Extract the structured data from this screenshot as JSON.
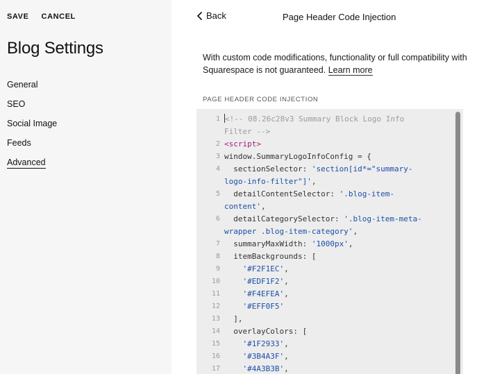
{
  "top_actions": {
    "save": "SAVE",
    "cancel": "CANCEL"
  },
  "left": {
    "title": "Blog Settings",
    "nav": [
      {
        "label": "General",
        "active": false
      },
      {
        "label": "SEO",
        "active": false
      },
      {
        "label": "Social Image",
        "active": false
      },
      {
        "label": "Feeds",
        "active": false
      },
      {
        "label": "Advanced",
        "active": true
      }
    ]
  },
  "right": {
    "back_label": "Back",
    "header_title": "Page Header Code Injection",
    "warning_text": "With custom code modifications, functionality or full compatibility with Squarespace is not guaranteed.",
    "learn_more": "Learn more",
    "section_label": "PAGE HEADER CODE INJECTION"
  },
  "code_lines": [
    {
      "num": "1",
      "parts": [
        {
          "t": "<!-- 08.26c28v3 Summary Block Logo Info Filter -->",
          "c": "comment"
        }
      ]
    },
    {
      "num": "2",
      "parts": [
        {
          "t": "<script>",
          "c": "tag"
        }
      ]
    },
    {
      "num": "3",
      "parts": [
        {
          "t": "window.SummaryLogoInfoConfig = {",
          "c": ""
        }
      ]
    },
    {
      "num": "4",
      "parts": [
        {
          "t": "  sectionSelector: ",
          "c": ""
        },
        {
          "t": "'section[id*=\"summary-logo-info-filter\"]'",
          "c": "str"
        },
        {
          "t": ",",
          "c": ""
        }
      ]
    },
    {
      "num": "5",
      "parts": [
        {
          "t": "  detailContentSelector: ",
          "c": ""
        },
        {
          "t": "'.blog-item-content'",
          "c": "str"
        },
        {
          "t": ",",
          "c": ""
        }
      ]
    },
    {
      "num": "6",
      "parts": [
        {
          "t": "  detailCategorySelector: ",
          "c": ""
        },
        {
          "t": "'.blog-item-meta-wrapper .blog-item-category'",
          "c": "str"
        },
        {
          "t": ",",
          "c": ""
        }
      ]
    },
    {
      "num": "7",
      "parts": [
        {
          "t": "  summaryMaxWidth: ",
          "c": ""
        },
        {
          "t": "'1000px'",
          "c": "str"
        },
        {
          "t": ",",
          "c": ""
        }
      ]
    },
    {
      "num": "8",
      "parts": [
        {
          "t": "  itemBackgrounds: [",
          "c": ""
        }
      ]
    },
    {
      "num": "9",
      "parts": [
        {
          "t": "    ",
          "c": ""
        },
        {
          "t": "'#F2F1EC'",
          "c": "str"
        },
        {
          "t": ",",
          "c": ""
        }
      ]
    },
    {
      "num": "10",
      "parts": [
        {
          "t": "    ",
          "c": ""
        },
        {
          "t": "'#EDF1F2'",
          "c": "str"
        },
        {
          "t": ",",
          "c": ""
        }
      ]
    },
    {
      "num": "11",
      "parts": [
        {
          "t": "    ",
          "c": ""
        },
        {
          "t": "'#F4EFEA'",
          "c": "str"
        },
        {
          "t": ",",
          "c": ""
        }
      ]
    },
    {
      "num": "12",
      "parts": [
        {
          "t": "    ",
          "c": ""
        },
        {
          "t": "'#EFF0F5'",
          "c": "str"
        }
      ]
    },
    {
      "num": "13",
      "parts": [
        {
          "t": "  ],",
          "c": ""
        }
      ]
    },
    {
      "num": "14",
      "parts": [
        {
          "t": "  overlayColors: [",
          "c": ""
        }
      ]
    },
    {
      "num": "15",
      "parts": [
        {
          "t": "    ",
          "c": ""
        },
        {
          "t": "'#1F2933'",
          "c": "str"
        },
        {
          "t": ",",
          "c": ""
        }
      ]
    },
    {
      "num": "16",
      "parts": [
        {
          "t": "    ",
          "c": ""
        },
        {
          "t": "'#3B4A3F'",
          "c": "str"
        },
        {
          "t": ",",
          "c": ""
        }
      ]
    },
    {
      "num": "17",
      "parts": [
        {
          "t": "    ",
          "c": ""
        },
        {
          "t": "'#4A3B3B'",
          "c": "str"
        },
        {
          "t": ",",
          "c": ""
        }
      ]
    }
  ]
}
